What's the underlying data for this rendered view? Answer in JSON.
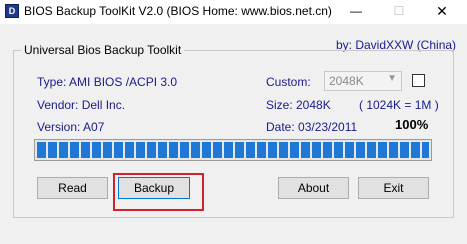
{
  "window": {
    "title": "BIOS Backup ToolKit V2.0 (BIOS Home: www.bios.net.cn)",
    "icon_letter": "D",
    "minimize": "—",
    "maximize": "☐",
    "close": "✕"
  },
  "group": {
    "title": "Universal Bios Backup Toolkit",
    "byline": "by:  DavidXXW    (China)"
  },
  "info": {
    "type": "Type: AMI BIOS  /ACPI 3.0",
    "vendor": "Vendor: Dell Inc.",
    "version": "Version: A07",
    "custom_label": "Custom:",
    "size": "Size: 2048K",
    "size_note": "( 1024K = 1M )",
    "date": "Date: 03/23/2011",
    "percent": "100%"
  },
  "custom_combo": {
    "value": "2048K",
    "arrow": "▼"
  },
  "progress": {
    "value": 1.0
  },
  "buttons": {
    "read": "Read",
    "backup": "Backup",
    "about": "About",
    "exit": "Exit"
  },
  "colors": {
    "info_text": "#1a1a8c",
    "progress_fill": "#1e78d6",
    "highlight": "#d4202a"
  }
}
